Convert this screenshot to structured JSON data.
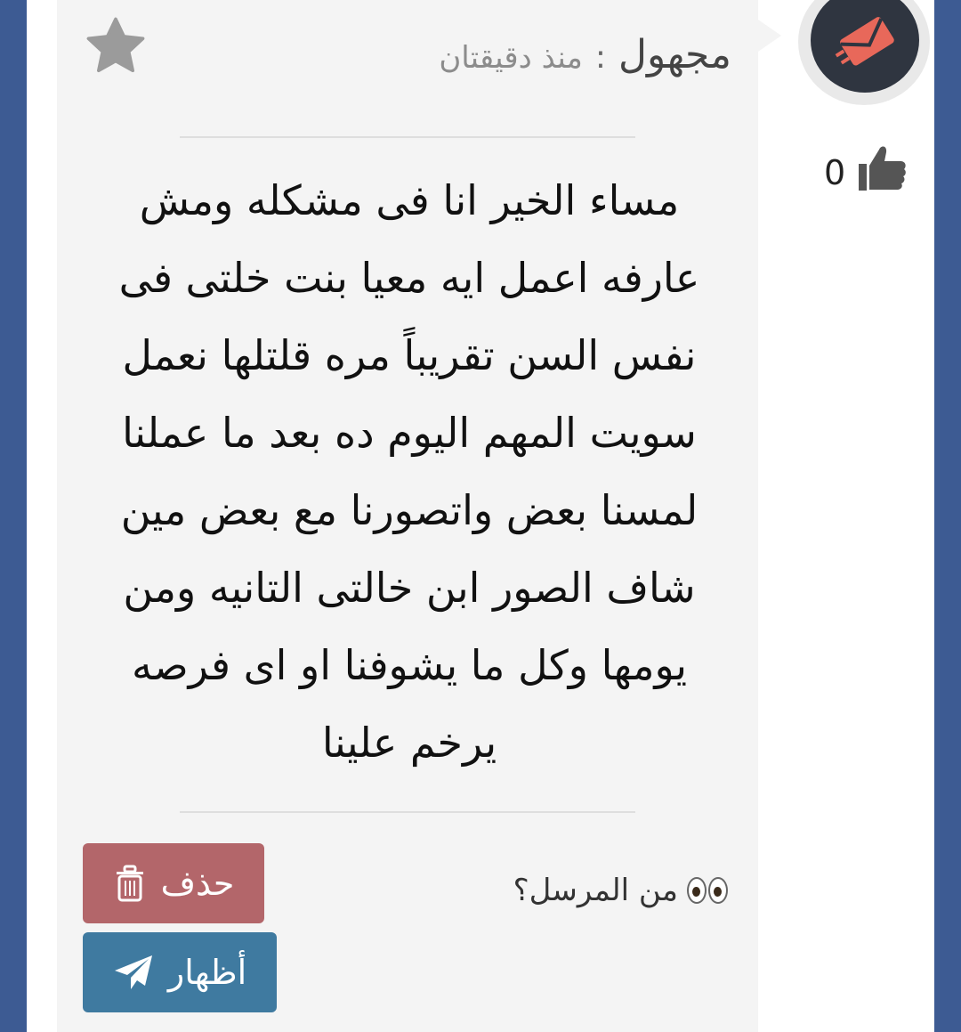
{
  "message_card": {
    "author": "مجهول",
    "separator": ":",
    "time": "منذ دقيقتان",
    "body": "مساء الخير انا فى مشكله ومش عارفه اعمل ايه معيا بنت خلتى فى نفس السن تقريباً مره قلتلها نعمل سويت المهم اليوم ده بعد ما عملنا لمسنا بعض واتصورنا مع بعض مين شاف الصور ابن خالتى التانيه ومن يومها وكل ما يشوفنا او اى فرصه يرخم علينا",
    "sender_question": "من المرسل؟"
  },
  "actions": {
    "delete_label": "حذف",
    "show_label": "أظهار"
  },
  "likes": {
    "count": "0"
  },
  "colors": {
    "frame": "#3d5b93",
    "card": "#f4f4f4",
    "delete_button": "#b3666a",
    "show_button": "#3f7aa0",
    "avatar_bg": "#2f3540",
    "avatar_icon": "#e8685a"
  },
  "icons": {
    "favorite": "star-icon",
    "like": "thumbs-up-icon",
    "delete": "trash-icon",
    "show": "paper-plane-icon",
    "avatar": "envelope-icon",
    "sender": "eyes-icon"
  }
}
